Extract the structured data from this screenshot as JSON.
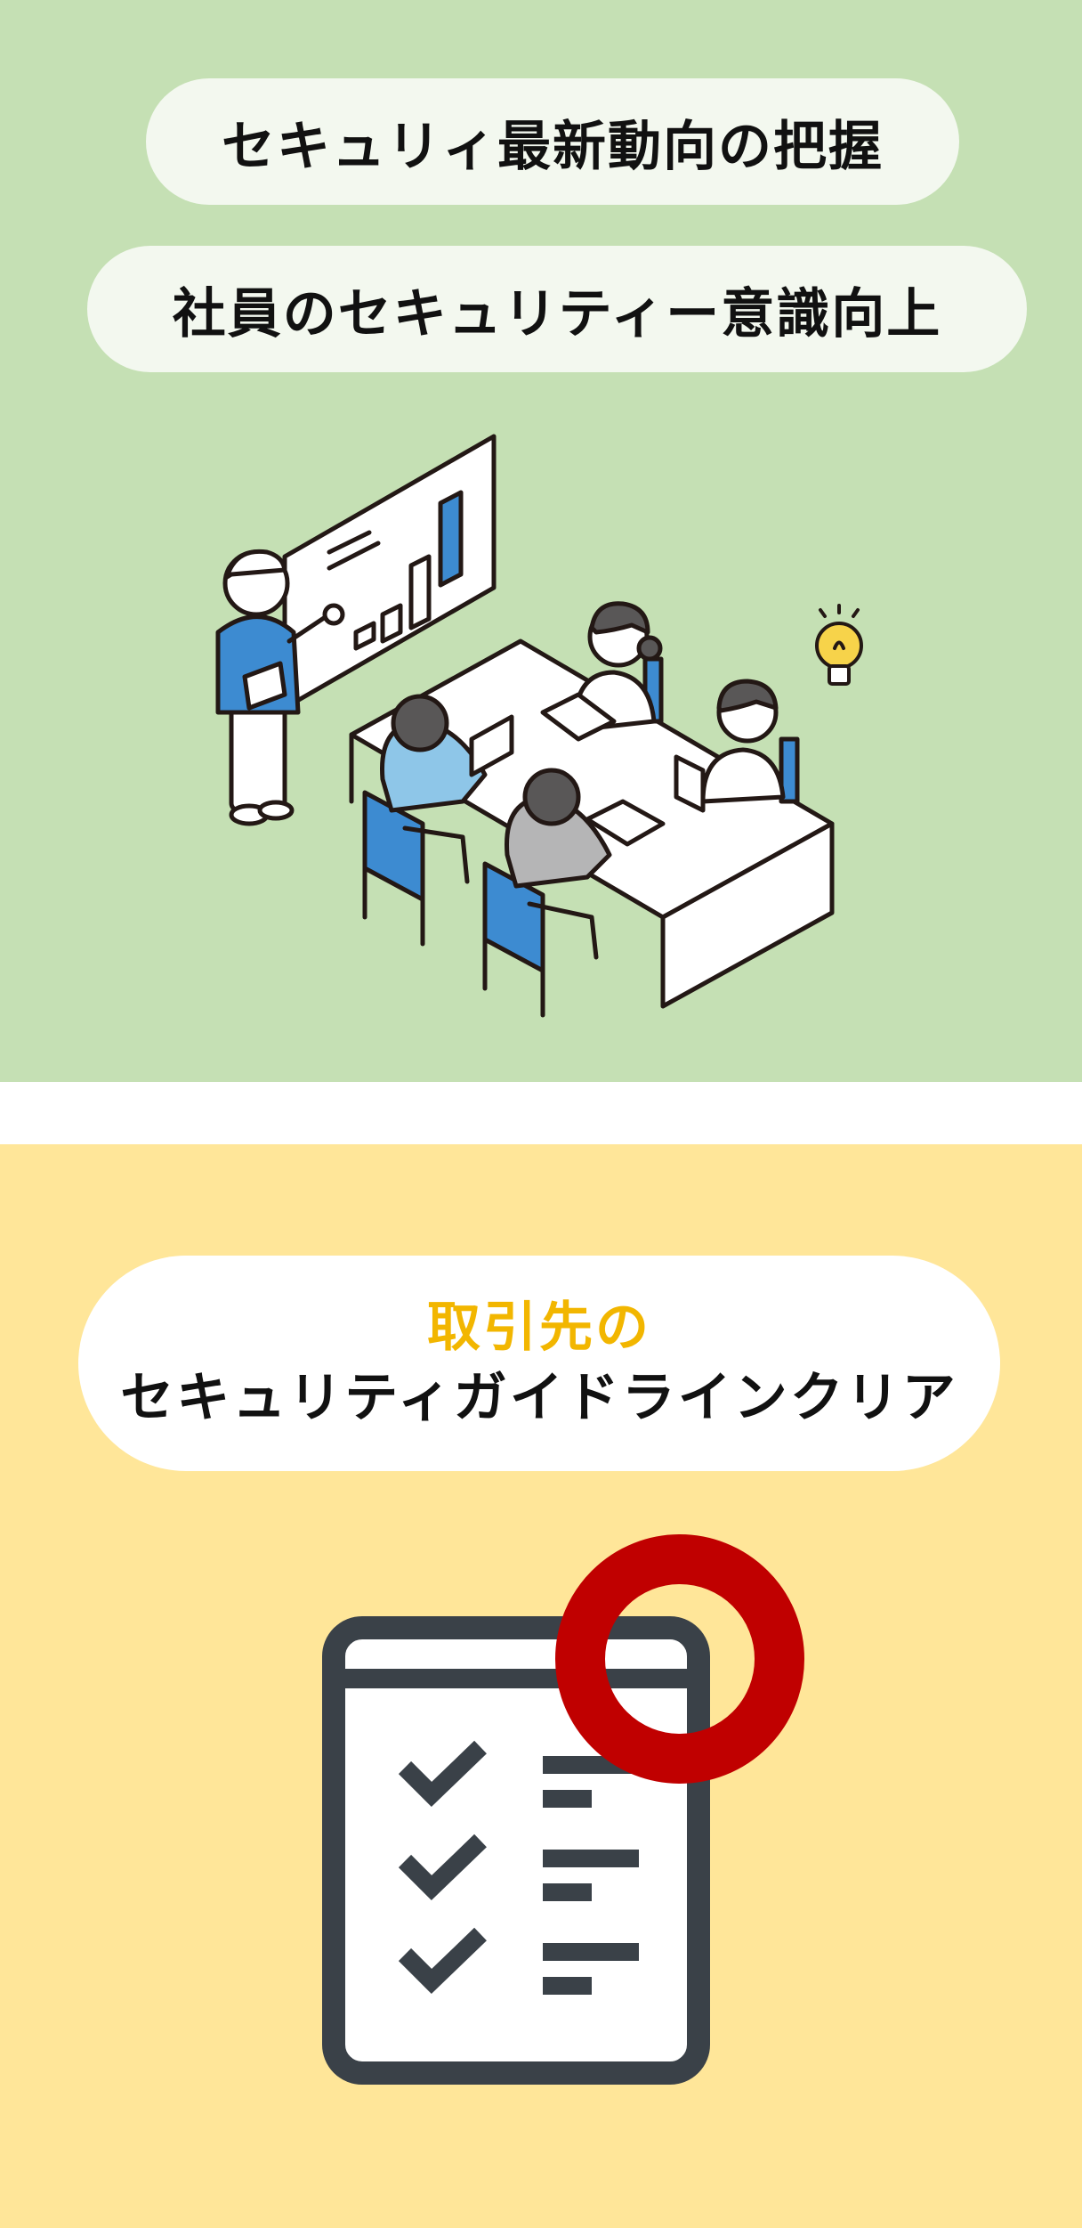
{
  "green_section": {
    "pill1": "セキュリィ最新動向の把握",
    "pill2": "社員のセキュリティー意識向上",
    "illustration_icon": "meeting-presentation-illustration",
    "bulb_icon": "lightbulb-icon"
  },
  "yellow_section": {
    "heading_line1": "取引先の",
    "heading_line2": "セキュリティガイドラインクリア",
    "checklist_icon": "checklist-icon",
    "circle_icon": "red-circle-icon"
  },
  "colors": {
    "green_bg": "#c5e0b4",
    "yellow_bg": "#ffe699",
    "accent_yellow": "#f2b600",
    "accent_red": "#c00000",
    "icon_dark": "#3a4148",
    "person_blue": "#3d8bd1"
  }
}
